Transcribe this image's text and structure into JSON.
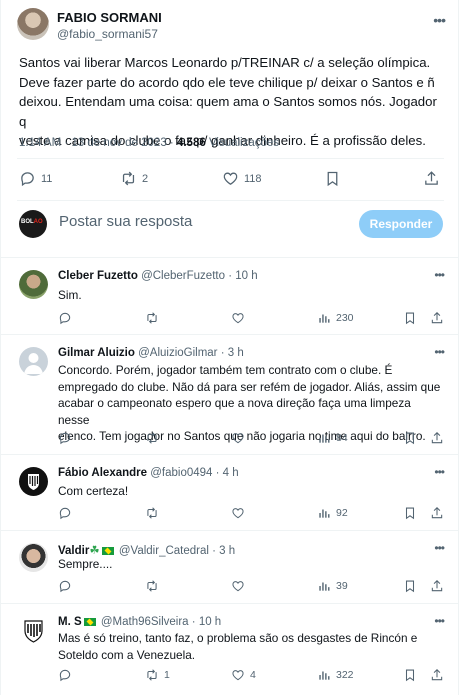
{
  "tweet": {
    "author_name": "FABIO SORMANI",
    "author_handle": "@fabio_sormani57",
    "text": "Santos vai liberar Marcos Leonardo p/TREINAR c/ a seleção olímpica.\nDeve fazer parte do acordo qdo ele teve chilique p/ deixar o Santos e ñ\ndeixou. Entendam uma coisa: quem ama o Santos somos nós. Jogador q\nveste a camisa do clube o faz p/ ganhar dinheiro. É a profissão deles.",
    "time": "1:14 AM",
    "date": "13 de nov de 2023",
    "views_count": "4.586",
    "views_label": "Visualizações",
    "replies": "11",
    "retweets": "2",
    "likes": "118",
    "more_icon": "ellipsis-icon"
  },
  "composer": {
    "placeholder": "Postar sua resposta",
    "button_label": "Responder",
    "avatar_logo_a": "BOL",
    "avatar_logo_b": "AO"
  },
  "replies": [
    {
      "name": "Cleber Fuzetto",
      "handle": "@CleberFuzetto",
      "time": "· 10 h",
      "text": "Sim.",
      "replies": "",
      "retweets": "",
      "likes": "",
      "views": "230"
    },
    {
      "name": "Gilmar Aluizio",
      "handle": "@AluizioGilmar",
      "time": "· 3 h",
      "text": "Concordo. Porém, jogador também tem contrato com o clube. É\nempregado do clube. Não dá para ser refém de jogador. Aliás, assim que\nacabar o campeonato espero que a nova direção faça uma limpeza nesse\nelenco. Tem jogador no Santos que não jogaria no time aqui do bairro.",
      "replies": "",
      "retweets": "",
      "likes": "",
      "views": "84"
    },
    {
      "name": "Fábio Alexandre",
      "handle": "@fabio0494",
      "time": "· 4 h",
      "text": "Com certeza!",
      "replies": "",
      "retweets": "",
      "likes": "",
      "views": "92"
    },
    {
      "name": "Valdir",
      "name_emoji": "☘",
      "handle": "@Valdir_Catedral",
      "time": "· 3 h",
      "text": "Sempre....",
      "replies": "",
      "retweets": "",
      "likes": "",
      "views": "39"
    },
    {
      "name": "M. S",
      "handle": "@Math96Silveira",
      "time": "· 10 h",
      "text": "Mas é só treino, tanto faz, o problema são os desgastes de Rincón e\nSoteldo com a Venezuela.",
      "replies": "",
      "retweets": "1",
      "likes": "4",
      "views": "322"
    }
  ],
  "colors": {
    "text": "#0f1419",
    "muted": "#536471",
    "border": "#eff3f4",
    "button": "#8ecdf8"
  }
}
